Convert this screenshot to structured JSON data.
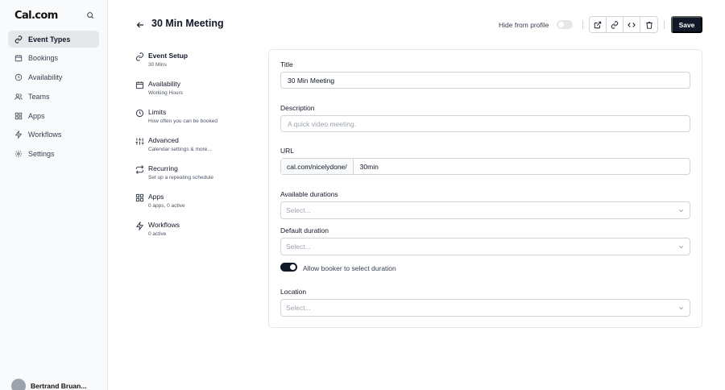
{
  "sidebar": {
    "logo": "Cal.com",
    "items": [
      {
        "label": "Event Types",
        "icon": "link-icon",
        "active": true
      },
      {
        "label": "Bookings",
        "icon": "calendar-icon"
      },
      {
        "label": "Availability",
        "icon": "clock-icon"
      },
      {
        "label": "Teams",
        "icon": "users-icon"
      },
      {
        "label": "Apps",
        "icon": "grid-icon"
      },
      {
        "label": "Workflows",
        "icon": "zap-icon"
      },
      {
        "label": "Settings",
        "icon": "gear-icon"
      }
    ],
    "user_name": "Bertrand Bruan..."
  },
  "header": {
    "title": "30 Min Meeting",
    "hide_label": "Hide from profile",
    "save_label": "Save"
  },
  "steps": [
    {
      "title": "Event Setup",
      "desc": "30 Mins",
      "icon": "link-icon"
    },
    {
      "title": "Availability",
      "desc": "Working Hours",
      "icon": "calendar-icon"
    },
    {
      "title": "Limits",
      "desc": "How often you can be booked",
      "icon": "clock-icon"
    },
    {
      "title": "Advanced",
      "desc": "Calendar settings & more...",
      "icon": "sliders-icon"
    },
    {
      "title": "Recurring",
      "desc": "Set up a repeating schedule",
      "icon": "repeat-icon"
    },
    {
      "title": "Apps",
      "desc": "0 apps, 0 active",
      "icon": "grid-icon"
    },
    {
      "title": "Workflows",
      "desc": "0 active",
      "icon": "zap-icon"
    }
  ],
  "form": {
    "title_label": "Title",
    "title_value": "30 Min Meeting",
    "description_label": "Description",
    "description_placeholder": "A quick video meeting.",
    "url_label": "URL",
    "url_prefix": "cal.com/nicelydone/",
    "url_slug": "30min",
    "durations_label": "Available durations",
    "durations_placeholder": "Select...",
    "default_duration_label": "Default duration",
    "default_duration_placeholder": "Select...",
    "allow_booker_label": "Allow booker to select duration",
    "location_label": "Location",
    "location_placeholder": "Select..."
  }
}
